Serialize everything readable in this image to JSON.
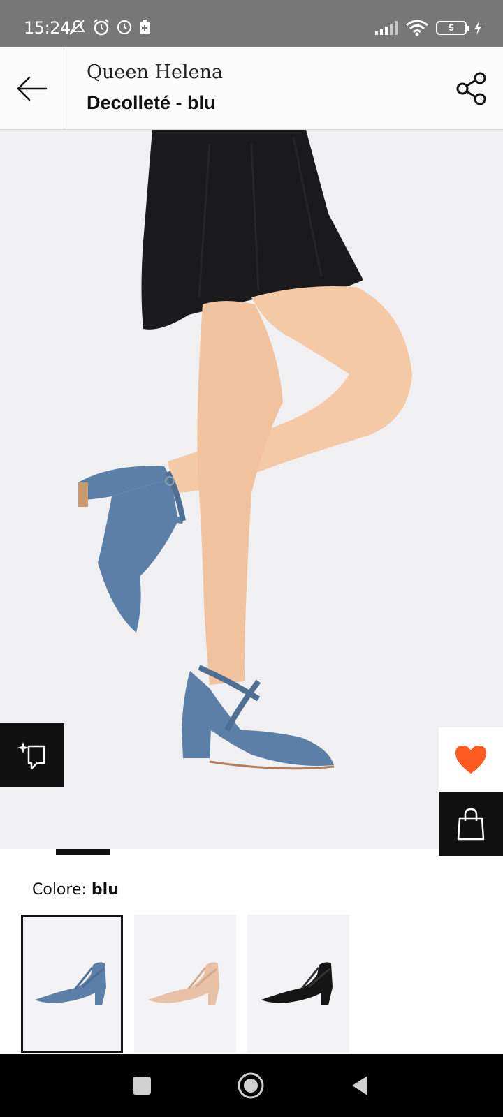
{
  "status_bar": {
    "time": "15:24",
    "battery_level": "5",
    "icons_left": [
      "mute-icon",
      "alarm-icon",
      "clock-icon",
      "battery-saver-icon"
    ],
    "icons_right": [
      "signal-icon",
      "wifi-icon",
      "battery-icon",
      "charging-icon"
    ]
  },
  "header": {
    "brand": "Queen Helena",
    "title": "Decolleté - blu"
  },
  "actions": {
    "favorite_color": "#ff5a1f"
  },
  "gallery": {
    "active_index": 0
  },
  "color_section": {
    "label": "Colore:",
    "value": "blu",
    "swatches": [
      {
        "name": "blu",
        "color": "#5b7fa6",
        "selected": true
      },
      {
        "name": "beige",
        "color": "#e8c1a6",
        "selected": false
      },
      {
        "name": "nero",
        "color": "#151515",
        "selected": false
      }
    ]
  },
  "colors": {
    "status_bar_bg": "#777777",
    "header_bg": "#fbfbfb",
    "image_bg": "#f0f0f2",
    "shoe_blue": "#5b7fa6",
    "skirt": "#1a1a1c",
    "skin": "#f3c9a6"
  }
}
